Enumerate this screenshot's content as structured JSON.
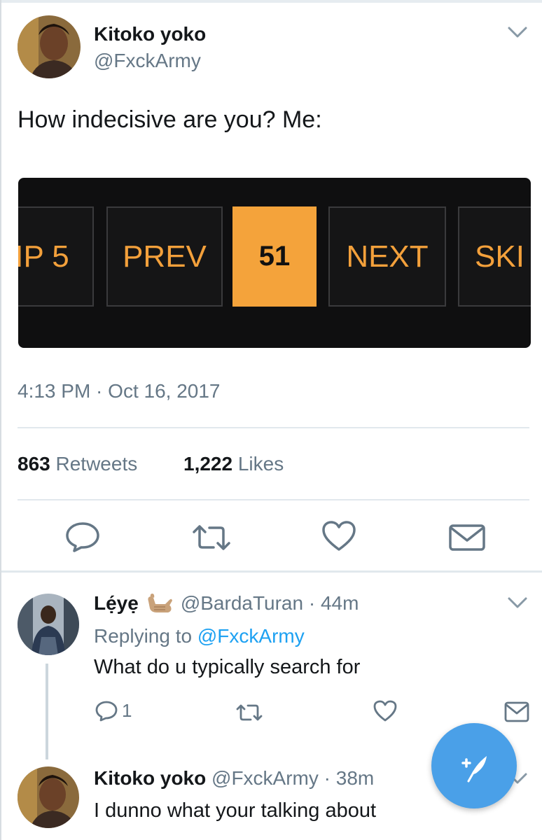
{
  "main_tweet": {
    "author_name": "Kitoko yoko",
    "author_handle": "@FxckArmy",
    "text": "How indecisive are you? Me:",
    "media": {
      "buttons": [
        "IP 5",
        "PREV",
        "51",
        "NEXT",
        "SKI"
      ],
      "current_page": "51",
      "accent_color": "#f4a33b"
    },
    "timestamp": "4:13 PM · Oct 16, 2017",
    "retweets_count": "863",
    "retweets_label": "Retweets",
    "likes_count": "1,222",
    "likes_label": "Likes",
    "actions": [
      "reply-icon",
      "retweet-icon",
      "like-icon",
      "direct-message-icon"
    ]
  },
  "replies": [
    {
      "author_name": "Lẹ́yẹ",
      "emoji": "call-me-hand-emoji",
      "author_handle": "@BardaTuran",
      "time": "· 44m",
      "replying_prefix": "Replying to",
      "replying_to": "@FxckArmy",
      "text": "What do u typically search for",
      "reply_count": "1"
    },
    {
      "author_name": "Kitoko yoko",
      "author_handle": "@FxckArmy",
      "time": "· 38m",
      "text": "I dunno what your talking about"
    }
  ],
  "colors": {
    "link_blue": "#1da1f2",
    "secondary_text": "#657786",
    "fab_blue": "#4aa0e8"
  }
}
